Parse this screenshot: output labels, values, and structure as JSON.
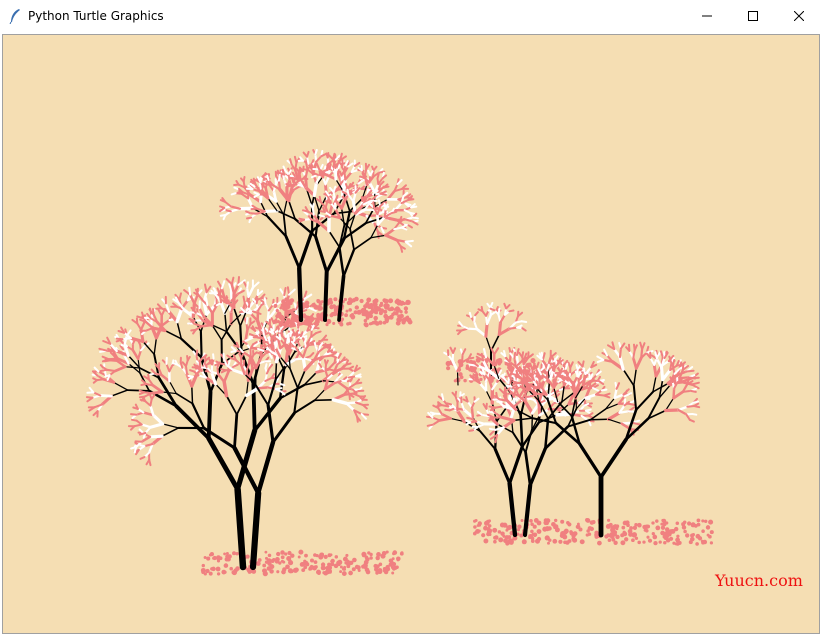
{
  "window": {
    "title": "Python Turtle Graphics"
  },
  "titlebar_icons": {
    "app": "feather-icon",
    "minimize": "minimize-icon",
    "maximize": "maximize-icon",
    "close": "close-icon"
  },
  "canvas": {
    "background": "#f5deb3",
    "watermark": "Yuucn.com"
  },
  "colors": {
    "trunk": "#000000",
    "blossom": "#f08080",
    "blossom_white": "#ffffff",
    "watermark": "#ee1111"
  }
}
